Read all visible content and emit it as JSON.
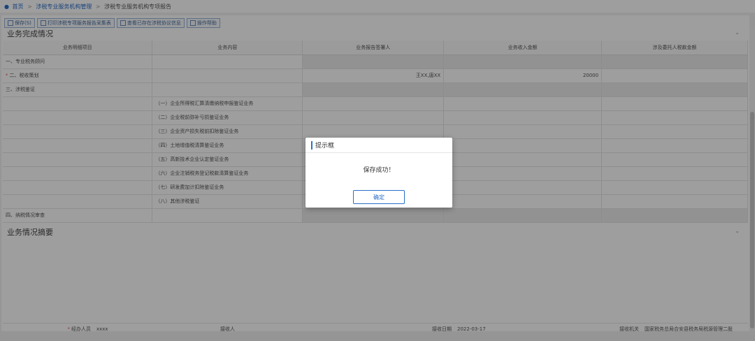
{
  "breadcrumb": {
    "home": "首页",
    "level1": "涉税专业服务机构管理",
    "level2": "涉税专业服务机构专项报告"
  },
  "toolbar": {
    "buttons": [
      "保存(S)",
      "打印涉税专项服务报告采集表",
      "查看已存在涉税协议信息",
      "操作帮助"
    ]
  },
  "sections": {
    "completion": "业务完成情况",
    "summary": "业务情况摘要"
  },
  "table": {
    "headers": [
      "业务明细项目",
      "业务内容",
      "业务报告签署人",
      "业务收入金额",
      "涉及委托人税款金额"
    ],
    "rows": [
      {
        "item": "一、专业税务顾问",
        "content": "",
        "signer": "",
        "income": "",
        "tax": ""
      },
      {
        "item": "二、税收策划",
        "content": "",
        "signer": "王XX,唐XX",
        "income": "20000",
        "tax": ""
      },
      {
        "item": "三、涉税鉴证",
        "content": "",
        "signer": "",
        "income": "",
        "tax": ""
      },
      {
        "item": "",
        "content": "（一）企业所得税汇算清缴纳税申报鉴证业务",
        "signer": "",
        "income": "",
        "tax": ""
      },
      {
        "item": "",
        "content": "（二）企业税前弥补亏损鉴证业务",
        "signer": "",
        "income": "",
        "tax": ""
      },
      {
        "item": "",
        "content": "（三）企业资产损失税前扣除鉴证业务",
        "signer": "",
        "income": "",
        "tax": ""
      },
      {
        "item": "",
        "content": "（四）土地增值税清算鉴证业务",
        "signer": "",
        "income": "",
        "tax": ""
      },
      {
        "item": "",
        "content": "（五）高新技术企业认定鉴证业务",
        "signer": "",
        "income": "",
        "tax": ""
      },
      {
        "item": "",
        "content": "（六）企业注销税务登记税款清算鉴证业务",
        "signer": "",
        "income": "",
        "tax": ""
      },
      {
        "item": "",
        "content": "（七）研发费加计扣除鉴证业务",
        "signer": "",
        "income": "",
        "tax": ""
      },
      {
        "item": "",
        "content": "（八）其他涉税鉴证",
        "signer": "",
        "income": "",
        "tax": ""
      },
      {
        "item": "四、纳税情况审查",
        "content": "",
        "signer": "",
        "income": "",
        "tax": ""
      }
    ]
  },
  "footer": {
    "handler_label": "经办人员",
    "handler_value": "xxxx",
    "receiver_label": "接收人",
    "receiver_value": "",
    "date_label": "接收日期",
    "date_value": "2022-03-17",
    "org_label": "接收机关",
    "org_value": "国家税务总局合安县税务局税源管理二股"
  },
  "modal": {
    "title": "提示框",
    "message": "保存成功！",
    "confirm": "确定"
  },
  "colors": {
    "accent": "#2a6fc9",
    "required": "#ee5555"
  }
}
